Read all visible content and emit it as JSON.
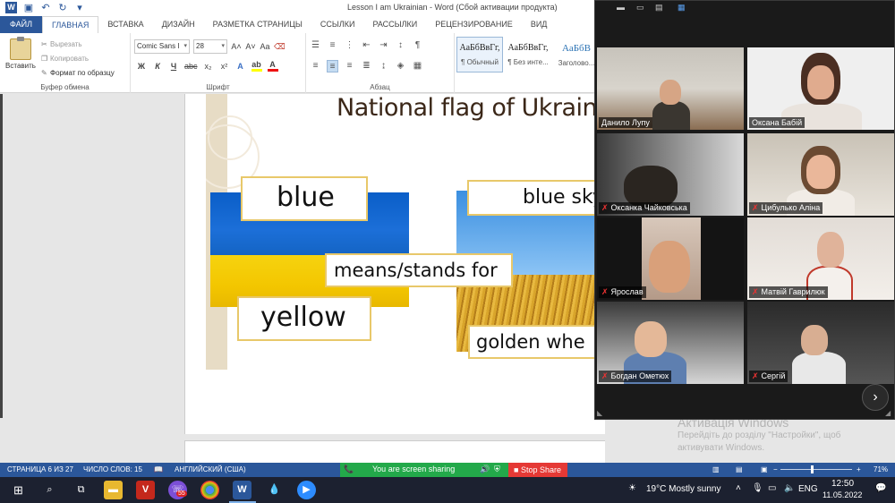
{
  "titlebar": {
    "title": "Lesson I am Ukrainian - Word (Сбой активации продукта)"
  },
  "tabs": [
    "ФАЙЛ",
    "ГЛАВНАЯ",
    "ВСТАВКА",
    "ДИЗАЙН",
    "РАЗМЕТКА СТРАНИЦЫ",
    "ССЫЛКИ",
    "РАССЫЛКИ",
    "РЕЦЕНЗИРОВАНИЕ",
    "ВИД"
  ],
  "ribbon": {
    "clipboard": {
      "paste": "Вставить",
      "cut": "Вырезать",
      "copy": "Копировать",
      "format_painter": "Формат по образцу",
      "group": "Буфер обмена"
    },
    "font": {
      "name": "Comic Sans I",
      "size": "28",
      "grow": "A˄",
      "shrink": "A˅",
      "case": "Aa",
      "bold": "Ж",
      "italic": "К",
      "underline": "Ч",
      "strike": "abc",
      "sub": "x₂",
      "sup": "x²",
      "group": "Шрифт"
    },
    "paragraph": {
      "group": "Абзац"
    },
    "styles": [
      {
        "sample": "АаБбВвГг,",
        "name": "¶ Обычный"
      },
      {
        "sample": "АаБбВвГг,",
        "name": "¶ Без инте..."
      },
      {
        "sample": "АаБбВ",
        "name": "Заголово..."
      }
    ]
  },
  "slide": {
    "title": "National flag of Ukrain",
    "label_blue": "blue",
    "label_yellow": "yellow",
    "label_means": "means/stands for",
    "label_sky": "blue sky",
    "label_wheat": "golden whe"
  },
  "participants": [
    {
      "name": "Данило Лупу",
      "muted": false
    },
    {
      "name": "Оксана Бабій",
      "muted": false
    },
    {
      "name": "Оксанка Чайковська",
      "muted": true
    },
    {
      "name": "Цибулько Аліна",
      "muted": true
    },
    {
      "name": "Ярослав",
      "muted": true
    },
    {
      "name": "Матвій Гаврилюк",
      "muted": true
    },
    {
      "name": "Богдан Ометюх",
      "muted": true
    },
    {
      "name": "Сергій",
      "muted": true
    }
  ],
  "watermark": {
    "line1": "Активація Windows",
    "line2": "Перейдіть до розділу \"Настройки\", щоб",
    "line3": "активувати Windows."
  },
  "statusbar": {
    "page": "СТРАНИЦА 6 ИЗ 27",
    "words": "ЧИСЛО СЛОВ: 15",
    "language": "АНГЛИЙСКИЙ (США)",
    "zoom": "71%"
  },
  "share": {
    "status": "You are screen sharing",
    "stop": "Stop Share"
  },
  "taskbar": {
    "weather": "19°C  Mostly sunny",
    "lang": "ENG",
    "time": "12:50",
    "date": "11.05.2022",
    "badge": "55"
  }
}
